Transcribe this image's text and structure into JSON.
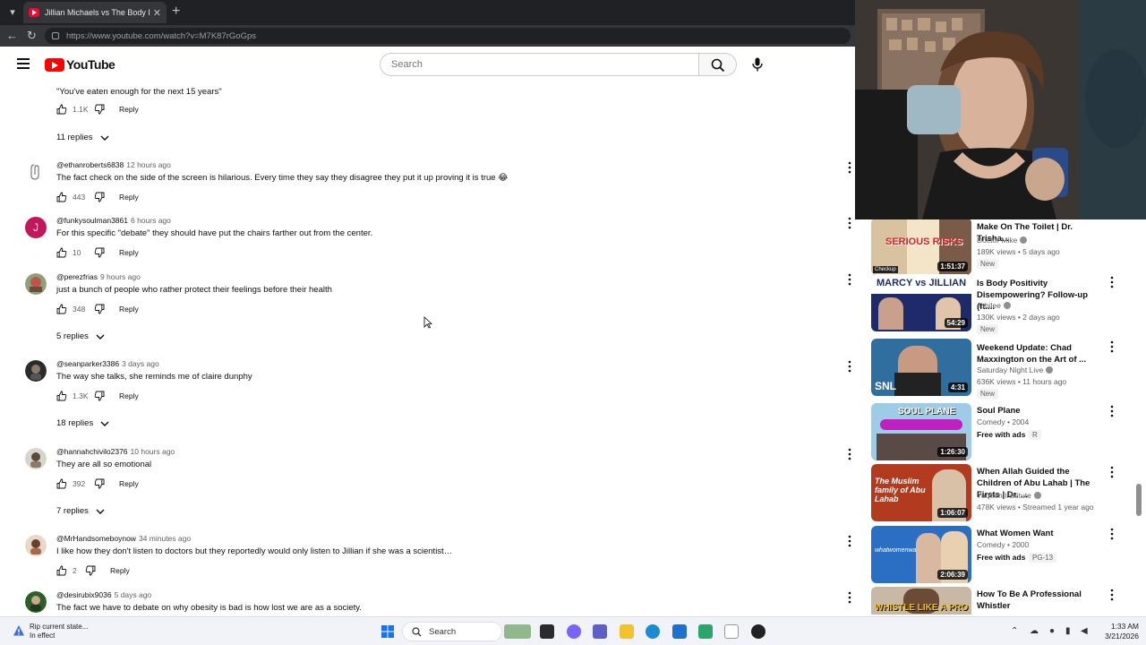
{
  "browser": {
    "tab_title": "Jillian Michaels vs The Body Positiv",
    "tab_close": "✕",
    "new_tab": "+",
    "url": "https://www.youtube.com/watch?v=M7K87rGoGps"
  },
  "header": {
    "logo_text": "YouTube",
    "search_placeholder": "Search"
  },
  "comments": {
    "first_text": "\"You've eaten enough for the next 15 years\"",
    "first_likes": "1.1K",
    "reply_label": "Reply",
    "items": [
      {
        "author": "@ethanroberts6838",
        "time": "12 hours ago",
        "text": "The fact check on the side of the screen is hilarious. Every time they say they disagree they put it up proving it is true 😂",
        "likes": "443"
      },
      {
        "author": "@funkysoulman3861",
        "time": "6 hours ago",
        "text": "For this specific \"debate\" they should have put the chairs farther out from the center.",
        "likes": "10",
        "avatar_letter": "J"
      },
      {
        "author": "@perezfrias",
        "time": "9 hours ago",
        "text": "just a bunch of people who rather protect their feelings before their health",
        "likes": "348"
      },
      {
        "author": "@seanparker3386",
        "time": "3 days ago",
        "text": "The way she talks, she reminds me of claire dunphy",
        "likes": "1.3K"
      },
      {
        "author": "@hannahchivilo2376",
        "time": "10 hours ago",
        "text": "They are all so emotional",
        "likes": "392"
      },
      {
        "author": "@MrHandsomeboynow",
        "time": "34 minutes ago",
        "text": "I like how they don't listen to doctors but they reportedly would only listen to Jillian if she was a scientist…",
        "likes": "2"
      },
      {
        "author": "@desirubix9036",
        "time": "5 days ago",
        "text": "The fact we have to debate on why obesity is bad is how lost we are as a society.",
        "likes": ""
      }
    ],
    "replies": [
      "11 replies",
      "5 replies",
      "18 replies",
      "7 replies"
    ]
  },
  "sidebar": {
    "videos": [
      {
        "title": "Make On The Toilet | Dr. Trisha...",
        "channel": "Doctor Mike",
        "verified": true,
        "meta": "189K views • 5 days ago",
        "badge": "New",
        "duration": "1:51:37",
        "thumb_text": "SERIOUS RISKS",
        "thumb_label": "Checkup"
      },
      {
        "title": "Is Body Positivity Disempowering? Follow-up (ft....",
        "channel": "Jubilee",
        "verified": true,
        "meta": "130K views • 2 days ago",
        "badge": "New",
        "duration": "54:29",
        "thumb_text": "MARCY vs JILLIAN"
      },
      {
        "title": "Weekend Update: Chad Maxxington on the Art of ...",
        "channel": "Saturday Night Live",
        "verified": true,
        "meta": "636K views • 11 hours ago",
        "badge": "New",
        "duration": "4:31",
        "thumb_text": "SNL"
      },
      {
        "title": "Soul Plane",
        "channel": "Comedy • 2004",
        "verified": false,
        "free": "Free with ads",
        "rating": "R",
        "duration": "1:26:30",
        "thumb_text": "SOUL PLANE"
      },
      {
        "title": "When Allah Guided the Children of Abu Lahab | The Firsts | Dr. ...",
        "channel": "Yaqeen Institute",
        "verified": true,
        "meta": "478K views • Streamed 1 year ago",
        "duration": "1:06:07",
        "thumb_text": "The Muslim family of Abu Lahab"
      },
      {
        "title": "What Women Want",
        "channel": "Comedy • 2000",
        "verified": false,
        "free": "Free with ads",
        "rating": "PG-13",
        "duration": "2:06:39",
        "thumb_text": "whatwomenwant"
      },
      {
        "title": "How To Be A Professional Whistler",
        "channel": "",
        "verified": false,
        "thumb_text": "WHISTLE LIKE A PRO"
      }
    ]
  },
  "taskbar": {
    "notice_title": "Rip current state...",
    "notice_sub": "In effect",
    "search": "Search",
    "time": "1:33 AM",
    "date": "3/21/2026"
  },
  "colors": {
    "yt_red": "#ff0000",
    "chrome_dark": "#202124",
    "link_blue": "#065fd4"
  }
}
